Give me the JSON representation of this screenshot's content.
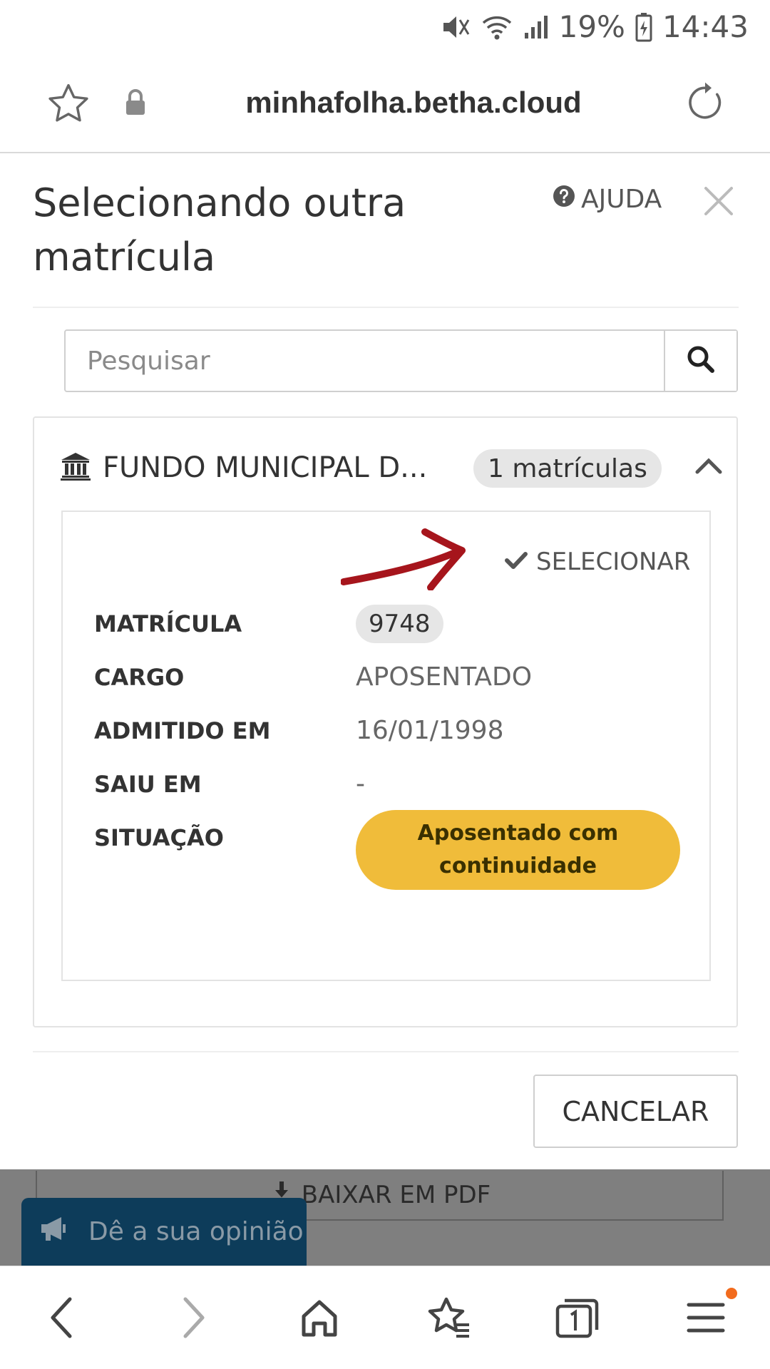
{
  "status_bar": {
    "battery": "19%",
    "time": "14:43",
    "icons": [
      "mute-vibrate-icon",
      "wifi-icon",
      "signal-icon",
      "battery-charging-icon"
    ]
  },
  "browser": {
    "url": "minhafolha.betha.cloud",
    "icons": [
      "star-icon",
      "lock-icon",
      "reload-icon"
    ]
  },
  "modal": {
    "title": "Selecionando outra matrícula",
    "help_label": "AJUDA",
    "search_placeholder": "Pesquisar",
    "group": {
      "name": "FUNDO MUNICIPAL D...",
      "count": "1 matrículas",
      "card": {
        "select_label": "SELECIONAR",
        "rows": {
          "matricula": {
            "label": "MATRÍCULA",
            "value": "9748"
          },
          "cargo": {
            "label": "CARGO",
            "value": "APOSENTADO"
          },
          "admitido": {
            "label": "ADMITIDO EM",
            "value": "16/01/1998"
          },
          "saiu": {
            "label": "SAIU EM",
            "value": "-"
          },
          "situacao": {
            "label": "SITUAÇÃO",
            "value": "Aposentado com continuidade"
          }
        }
      }
    },
    "cancel_label": "CANCELAR"
  },
  "background_page": {
    "pdf_label": "BAIXAR EM PDF",
    "feedback_label": "Dê a sua opinião"
  },
  "colors": {
    "status_pill": "#f0bc3a",
    "annotation_arrow": "#a6151c",
    "feedback_bg": "#0d3c5a",
    "notification_dot": "#f26b1d"
  },
  "bottom_nav": [
    "back-icon",
    "forward-icon",
    "home-icon",
    "bookmarks-icon",
    "tabs-icon",
    "menu-icon"
  ]
}
